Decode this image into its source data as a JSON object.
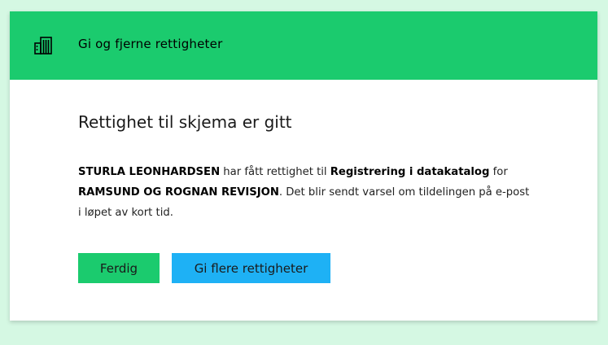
{
  "modal": {
    "header": {
      "title": "Gi og fjerne rettigheter",
      "icon": "building-icon"
    },
    "confirm_title": "Rettighet til skjema er gitt",
    "message": {
      "person": "STURLA LEONHARDSEN",
      "text1": " har fått rettighet til ",
      "service": "Registrering i datakatalog",
      "text2": " for ",
      "organization": "RAMSUND OG ROGNAN REVISJON",
      "text3": ". Det blir sendt varsel om tildelingen på e-post i løpet av kort tid."
    },
    "buttons": {
      "done_label": "Ferdig",
      "more_label": "Gi flere rettigheter"
    }
  },
  "colors": {
    "background": "#d5f8e3",
    "header": "#1bcb6e",
    "done_button": "#1bcb6e",
    "more_button": "#1eb1f5"
  }
}
